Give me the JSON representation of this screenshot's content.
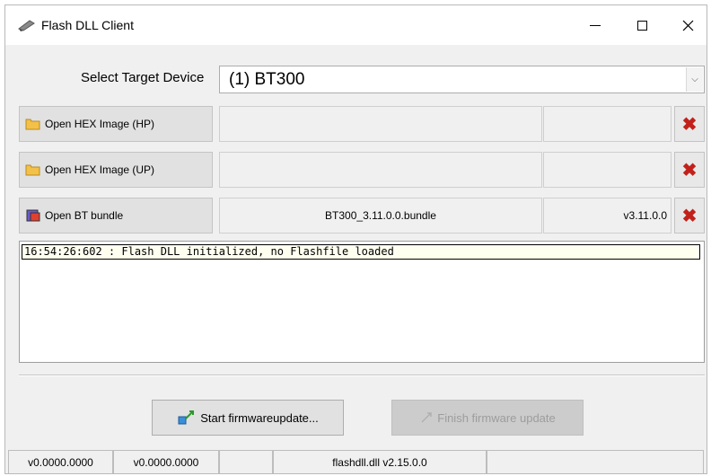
{
  "window": {
    "title": "Flash DLL Client"
  },
  "target": {
    "label": "Select Target Device",
    "selected": "(1) BT300"
  },
  "rows": [
    {
      "button": "Open HEX Image (HP)",
      "file": "",
      "version": ""
    },
    {
      "button": "Open HEX Image (UP)",
      "file": "",
      "version": ""
    },
    {
      "button": "Open BT bundle",
      "file": "BT300_3.11.0.0.bundle",
      "version": "v3.11.0.0"
    }
  ],
  "log": {
    "lines": [
      "16:54:26:602 : Flash DLL initialized, no Flashfile loaded"
    ]
  },
  "actions": {
    "start": "Start firmwareupdate...",
    "finish": "Finish firmware update"
  },
  "statusbar": {
    "cells": [
      "v0.0000.0000",
      "v0.0000.0000",
      "",
      "flashdll.dll v2.15.0.0",
      ""
    ]
  },
  "colors": {
    "remove_icon": "#c2211b",
    "folder_icon": "#f3c14a",
    "log_highlight": "#fffff0"
  },
  "icons": {
    "app": "pen-icon",
    "folder": "folder-icon",
    "bundle": "bundle-icon",
    "remove": "red-x-icon",
    "start": "flash-icon",
    "finish": "finish-icon"
  }
}
